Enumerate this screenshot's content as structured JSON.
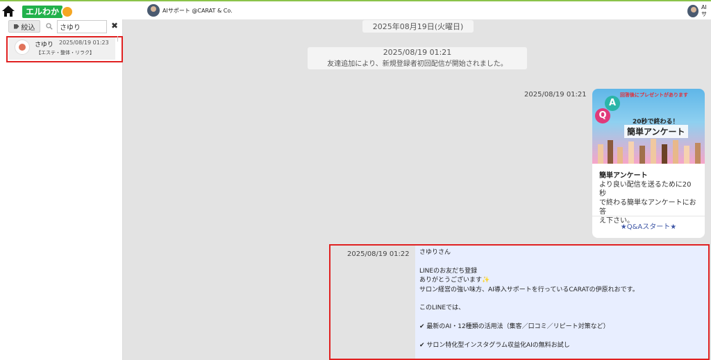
{
  "topbar": {
    "logo_text": "エルわか",
    "account_name": "AIサポート @CARAT & Co.",
    "account_name_cut": "AIサ"
  },
  "sidebar": {
    "filter_label": "絞込",
    "search_value": "さゆり",
    "clear_glyph": "✖",
    "contacts": [
      {
        "name": "さゆり",
        "time": "2025/08/19 01:23",
        "tag": "【エステ・整体・リラク】"
      }
    ]
  },
  "chat": {
    "date_separator": "2025年08月19日(火曜日)",
    "system": {
      "time": "2025/08/19 01:21",
      "message": "友達追加により、新規登録者初回配信が開始されました。"
    },
    "card": {
      "time": "2025/08/19 01:21",
      "banner": "回答後にプレゼントがあります",
      "image_sub": "20秒で終わる！",
      "image_title": "簡単アンケート",
      "title": "簡単アンケート",
      "description_lines": [
        "より良い配信を送るために20秒",
        "で終わる簡単なアンケートにお答",
        "え下さい。"
      ],
      "action": "★Q&Aスタート★"
    },
    "message": {
      "time": "2025/08/19 01:22",
      "lines": [
        "さゆりさん",
        "",
        "LINEのお友だち登録",
        "ありがとうございます✨",
        "サロン経営の強い味方、AI導入サポートを行っているCARATの伊原れおです。",
        "",
        "このLINEでは、",
        "",
        "✔ 最新のAI・12種類の活用法（集客／口コミ／リピート対策など）",
        "",
        "✔ サロン特化型インスタグラム収益化AIの無料お試し"
      ]
    }
  },
  "colors": {
    "highlight": "#e02020",
    "logo_green": "#21b14b",
    "link_blue": "#3f57a6",
    "chat_bg": "#e3e3e3"
  }
}
